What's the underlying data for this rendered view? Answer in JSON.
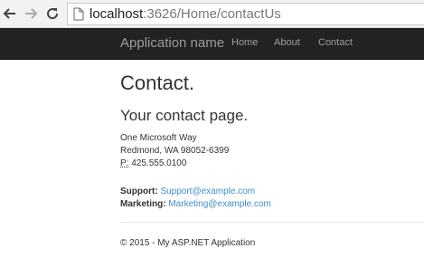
{
  "browser": {
    "url_host": "localhost",
    "url_path": ":3626/Home/contactUs",
    "icons": {
      "back": "arrow-left-icon",
      "forward": "arrow-right-icon",
      "reload": "reload-icon",
      "page": "page-icon"
    }
  },
  "navbar": {
    "brand": "Application name",
    "links": [
      {
        "label": "Home"
      },
      {
        "label": "About"
      },
      {
        "label": "Contact"
      }
    ],
    "colors": {
      "background": "#222222",
      "text": "#9d9d9d"
    }
  },
  "main": {
    "title": "Contact.",
    "subtitle": "Your contact page.",
    "address": {
      "line1": "One Microsoft Way",
      "line2": "Redmond, WA 98052-6399",
      "phone_label": "P:",
      "phone": "425.555.0100"
    },
    "contacts": [
      {
        "label": "Support:",
        "email": "Support@example.com"
      },
      {
        "label": "Marketing:",
        "email": "Marketing@example.com"
      }
    ],
    "link_color": "#428bca"
  },
  "footer": {
    "text": "© 2015 - My ASP.NET Application"
  }
}
